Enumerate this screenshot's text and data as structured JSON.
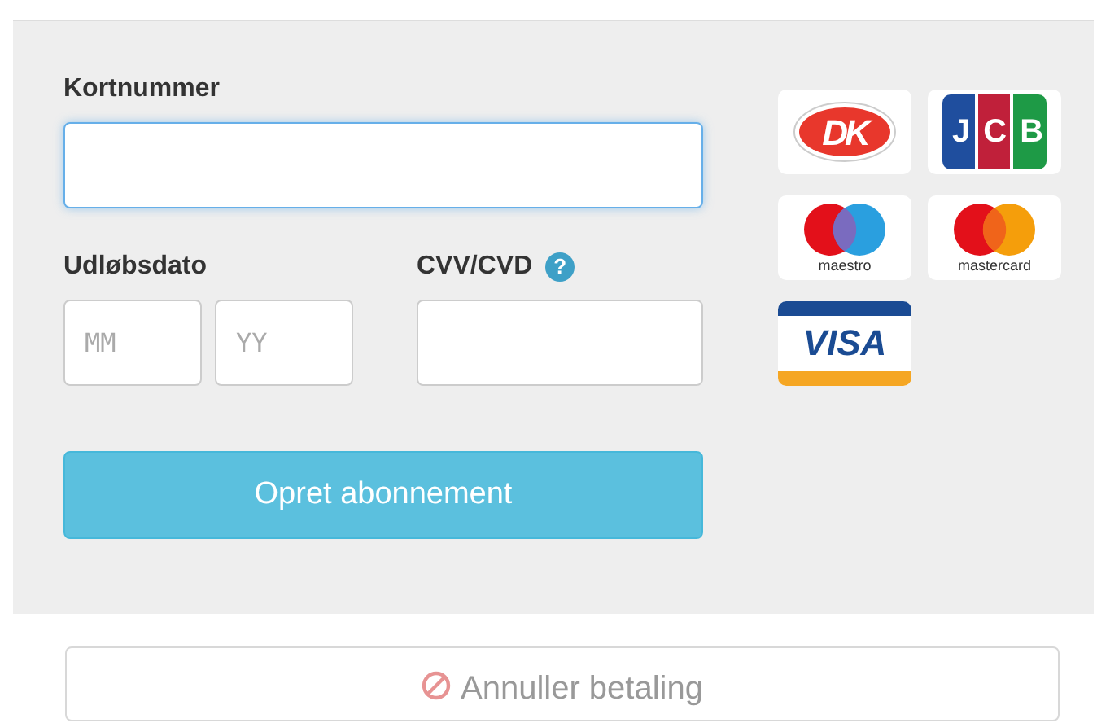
{
  "form": {
    "card_number": {
      "label": "Kortnummer",
      "focused": true
    },
    "expiry": {
      "label": "Udløbsdato",
      "month_placeholder": "MM",
      "year_placeholder": "YY"
    },
    "cvv": {
      "label": "CVV/CVD",
      "help_icon": "?"
    },
    "submit": {
      "label": "Opret abonnement"
    }
  },
  "cards": [
    {
      "kind": "dankort",
      "label": "DK"
    },
    {
      "kind": "jcb",
      "label": "JCB"
    },
    {
      "kind": "maestro",
      "label": "maestro"
    },
    {
      "kind": "mastercard",
      "label": "mastercard"
    },
    {
      "kind": "visa",
      "label": "VISA"
    }
  ],
  "cancel": {
    "label": "Annuller betaling",
    "disabled": true
  }
}
